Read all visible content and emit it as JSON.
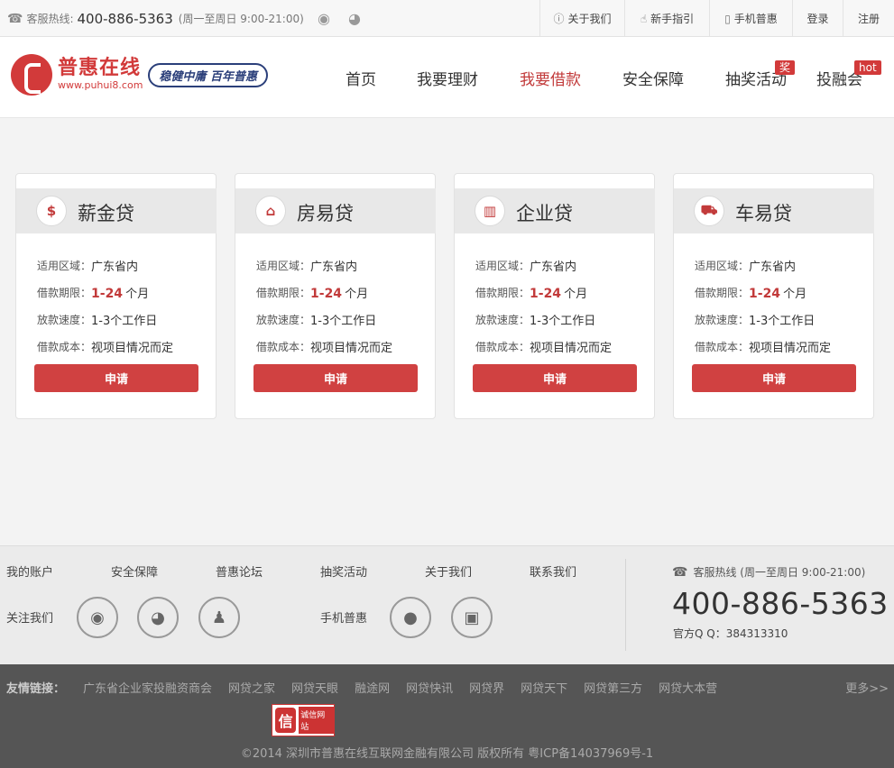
{
  "topbar": {
    "hotline_label": "客服热线:",
    "hotline_number": "400-886-5363",
    "hotline_hours": "(周一至周日 9:00-21:00)",
    "links": [
      {
        "icon": "info-icon",
        "glyph": "ⓘ",
        "label": "关于我们"
      },
      {
        "icon": "hand-pointer-icon",
        "glyph": "☝",
        "label": "新手指引"
      },
      {
        "icon": "mobile-icon",
        "glyph": "▯",
        "label": "手机普惠"
      },
      {
        "icon": "",
        "glyph": "",
        "label": "登录"
      },
      {
        "icon": "",
        "glyph": "",
        "label": "注册"
      }
    ]
  },
  "header": {
    "logo_name": "普惠在线",
    "logo_url": "www.puhui8.com",
    "slogan": "稳健中庸 百年普惠",
    "nav": [
      {
        "label": "首页",
        "active": false,
        "badge": ""
      },
      {
        "label": "我要理财",
        "active": false,
        "badge": ""
      },
      {
        "label": "我要借款",
        "active": true,
        "badge": ""
      },
      {
        "label": "安全保障",
        "active": false,
        "badge": ""
      },
      {
        "label": "抽奖活动",
        "active": false,
        "badge": "奖"
      },
      {
        "label": "投融会",
        "active": false,
        "badge": "hot"
      }
    ]
  },
  "cards": [
    {
      "title": "薪金贷",
      "icon": "dollar-icon",
      "glyph": "$",
      "region_label": "适用区域：",
      "region": "广东省内",
      "term_label": "借款期限：",
      "term": "1-24",
      "term_unit": "个月",
      "speed_label": "放款速度：",
      "speed": "1-3个工作日",
      "cost_label": "借款成本：",
      "cost": "视项目情况而定",
      "button": "申请"
    },
    {
      "title": "房易贷",
      "icon": "house-icon",
      "glyph": "⌂",
      "region_label": "适用区域：",
      "region": "广东省内",
      "term_label": "借款期限：",
      "term": "1-24",
      "term_unit": "个月",
      "speed_label": "放款速度：",
      "speed": "1-3个工作日",
      "cost_label": "借款成本：",
      "cost": "视项目情况而定",
      "button": "申请"
    },
    {
      "title": "企业贷",
      "icon": "building-icon",
      "glyph": "▥",
      "region_label": "适用区域：",
      "region": "广东省内",
      "term_label": "借款期限：",
      "term": "1-24",
      "term_unit": "个月",
      "speed_label": "放款速度：",
      "speed": "1-3个工作日",
      "cost_label": "借款成本：",
      "cost": "视项目情况而定",
      "button": "申请"
    },
    {
      "title": "车易贷",
      "icon": "truck-icon",
      "glyph": "⛟",
      "region_label": "适用区域：",
      "region": "广东省内",
      "term_label": "借款期限：",
      "term": "1-24",
      "term_unit": "个月",
      "speed_label": "放款速度：",
      "speed": "1-3个工作日",
      "cost_label": "借款成本：",
      "cost": "视项目情况而定",
      "button": "申请"
    }
  ],
  "footer": {
    "links": [
      "我的账户",
      "安全保障",
      "普惠论坛",
      "抽奖活动",
      "关于我们",
      "联系我们"
    ],
    "follow_label": "关注我们",
    "mobile_label": "手机普惠",
    "social": [
      {
        "icon": "weibo-icon",
        "glyph": "◉"
      },
      {
        "icon": "wechat-icon",
        "glyph": "◕"
      },
      {
        "icon": "qq-icon",
        "glyph": "♟"
      }
    ],
    "apps": [
      {
        "icon": "apple-icon",
        "glyph": "●"
      },
      {
        "icon": "android-icon",
        "glyph": "▣"
      }
    ],
    "hotline_label": "客服热线 (周一至周日 9:00-21:00)",
    "hotline_number": "400-886-5363",
    "qq": "官方Q Q：384313310"
  },
  "bottom": {
    "friends_label": "友情链接：",
    "friends": [
      "广东省企业家投融资商会",
      "网贷之家",
      "网贷天眼",
      "融途网",
      "网贷快讯",
      "网贷界",
      "网贷天下",
      "网贷第三方",
      "网贷大本营"
    ],
    "more": "更多>>",
    "trust_char": "信",
    "trust_text": "诚信网站",
    "copyright": "©2014 深圳市普惠在线互联网金融有限公司 版权所有 粤ICP备14037969号-1"
  }
}
